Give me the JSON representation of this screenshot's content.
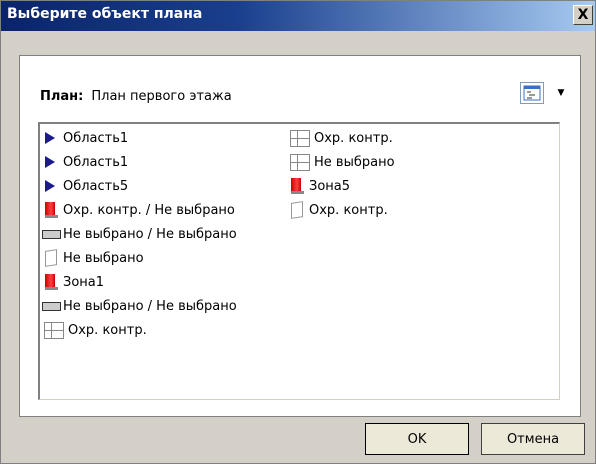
{
  "window": {
    "title": "Выберите объект плана",
    "close_symbol": "X"
  },
  "plan": {
    "label": "План:",
    "value": "План первого этажа"
  },
  "toolbar": {
    "view_button_icon": "list-view-icon",
    "dropdown_symbol": "▼"
  },
  "list": {
    "column1": [
      {
        "icon": "area-icon",
        "label": "Область1"
      },
      {
        "icon": "area-icon",
        "label": "Область1"
      },
      {
        "icon": "area-icon",
        "label": "Область5"
      },
      {
        "icon": "zone-icon",
        "label": "Охр. контр. / Не выбрано"
      },
      {
        "icon": "reader-icon",
        "label": "Не выбрано / Не выбрано"
      },
      {
        "icon": "empty-icon",
        "label": "Не выбрано"
      },
      {
        "icon": "zone-icon",
        "label": "Зона1"
      },
      {
        "icon": "reader-icon",
        "label": "Не выбрано / Не выбрано"
      },
      {
        "icon": "guard-panel-icon",
        "label": "Охр. контр."
      }
    ],
    "column2": [
      {
        "icon": "guard-panel-icon",
        "label": "Охр. контр."
      },
      {
        "icon": "guard-panel-icon",
        "label": "Не выбрано"
      },
      {
        "icon": "zone-icon",
        "label": "Зона5"
      },
      {
        "icon": "empty-icon",
        "label": "Охр. контр."
      }
    ]
  },
  "buttons": {
    "ok": "OK",
    "cancel": "Отмена"
  }
}
